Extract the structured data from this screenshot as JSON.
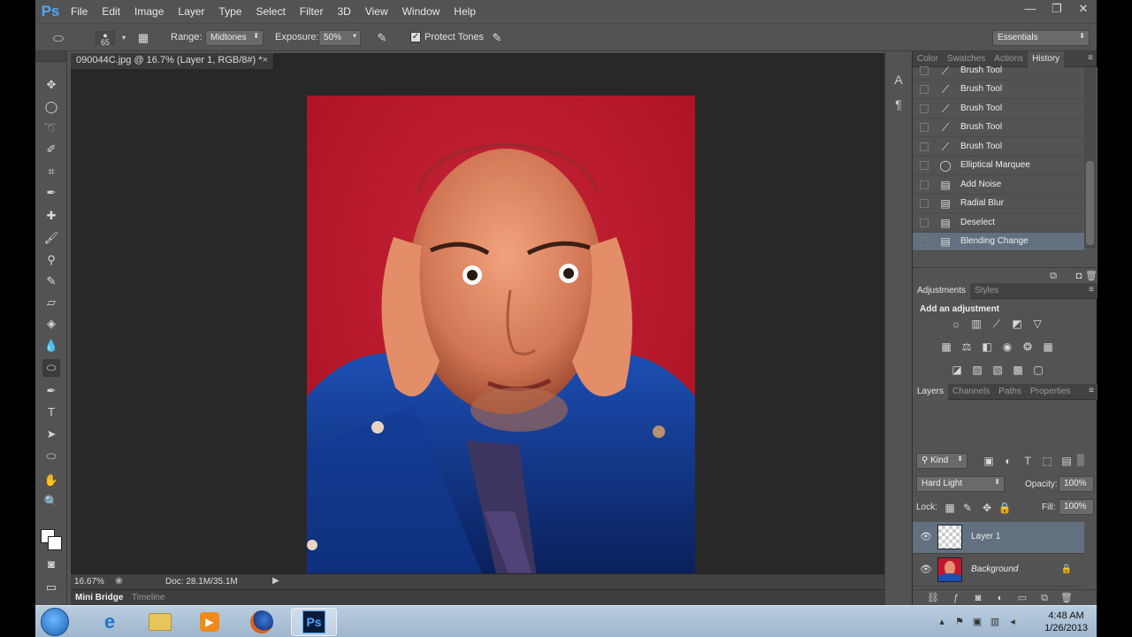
{
  "app": {
    "logo": "Ps",
    "menu": [
      "File",
      "Edit",
      "Image",
      "Layer",
      "Type",
      "Select",
      "Filter",
      "3D",
      "View",
      "Window",
      "Help"
    ],
    "window_controls": {
      "minimize": "—",
      "restore": "❐",
      "close": "✕"
    }
  },
  "options": {
    "brush_size": "65",
    "range_label": "Range:",
    "range_value": "Midtones",
    "exposure_label": "Exposure:",
    "exposure_value": "50%",
    "protect_tones_label": "Protect Tones",
    "protect_tones_checked": true,
    "workspace": "Essentials"
  },
  "document": {
    "tab_title": "090044C.jpg @ 16.7% (Layer 1, RGB/8#) *",
    "zoom": "16.67%",
    "doc_size": "Doc: 28.1M/35.1M"
  },
  "bottom_tabs": [
    "Mini Bridge",
    "Timeline"
  ],
  "history_panel": {
    "tabs": [
      "Color",
      "Swatches",
      "Actions",
      "History"
    ],
    "active_tab": "History",
    "items": [
      {
        "label": "Brush Tool",
        "icon": "brush-icon"
      },
      {
        "label": "Brush Tool",
        "icon": "brush-icon"
      },
      {
        "label": "Brush Tool",
        "icon": "brush-icon"
      },
      {
        "label": "Brush Tool",
        "icon": "brush-icon"
      },
      {
        "label": "Brush Tool",
        "icon": "brush-icon"
      },
      {
        "label": "Elliptical Marquee",
        "icon": "ellipse-icon"
      },
      {
        "label": "Add Noise",
        "icon": "document-icon"
      },
      {
        "label": "Radial Blur",
        "icon": "document-icon"
      },
      {
        "label": "Deselect",
        "icon": "document-icon"
      },
      {
        "label": "Blending Change",
        "icon": "document-icon"
      }
    ],
    "selected_index": 9
  },
  "adjustments_panel": {
    "tabs": [
      "Adjustments",
      "Styles"
    ],
    "title": "Add an adjustment"
  },
  "layers_panel": {
    "tabs": [
      "Layers",
      "Channels",
      "Paths",
      "Properties"
    ],
    "kind_filter": "Kind",
    "blend_mode": "Hard Light",
    "opacity_label": "Opacity:",
    "opacity": "100%",
    "lock_label": "Lock:",
    "fill_label": "Fill:",
    "fill": "100%",
    "layers": [
      {
        "name": "Layer 1",
        "selected": true
      },
      {
        "name": "Background",
        "selected": false,
        "locked": true
      }
    ]
  },
  "taskbar": {
    "time": "4:48 AM",
    "date": "1/26/2013",
    "apps": [
      "Internet Explorer",
      "Windows Explorer",
      "Media Player",
      "Firefox",
      "Photoshop"
    ],
    "active_app": "Photoshop"
  },
  "colors": {
    "ps_accent": "#4fa8ff",
    "panel_bg": "#535353",
    "selection": "#627080",
    "photo_bg": "#c2182d"
  }
}
